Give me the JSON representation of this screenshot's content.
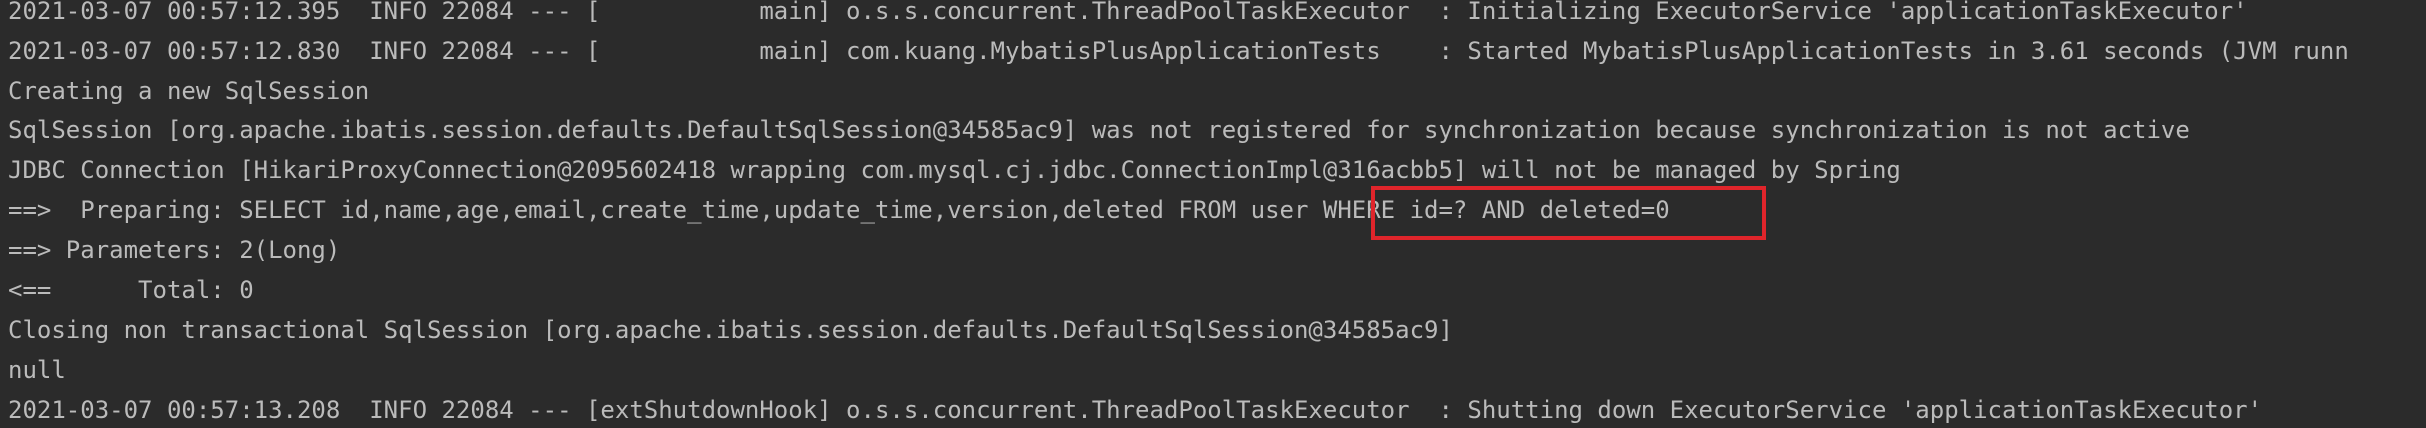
{
  "console": {
    "lines": [
      "2021-03-07 00:57:12.395  INFO 22084 --- [           main] o.s.s.concurrent.ThreadPoolTaskExecutor  : Initializing ExecutorService 'applicationTaskExecutor'",
      "2021-03-07 00:57:12.830  INFO 22084 --- [           main] com.kuang.MybatisPlusApplicationTests    : Started MybatisPlusApplicationTests in 3.61 seconds (JVM runn",
      "Creating a new SqlSession",
      "SqlSession [org.apache.ibatis.session.defaults.DefaultSqlSession@34585ac9] was not registered for synchronization because synchronization is not active",
      "JDBC Connection [HikariProxyConnection@2095602418 wrapping com.mysql.cj.jdbc.ConnectionImpl@316acbb5] will not be managed by Spring",
      "==>  Preparing: SELECT id,name,age,email,create_time,update_time,version,deleted FROM user WHERE id=? AND deleted=0",
      "==> Parameters: 2(Long)",
      "<==      Total: 0",
      "Closing non transactional SqlSession [org.apache.ibatis.session.defaults.DefaultSqlSession@34585ac9]",
      "null",
      "2021-03-07 00:57:13.208  INFO 22084 --- [extShutdownHook] o.s.s.concurrent.ThreadPoolTaskExecutor  : Shutting down ExecutorService 'applicationTaskExecutor'"
    ]
  },
  "colors": {
    "background": "#2b2b2b",
    "text": "#bbbbbb",
    "highlight_border": "#e0252b"
  }
}
